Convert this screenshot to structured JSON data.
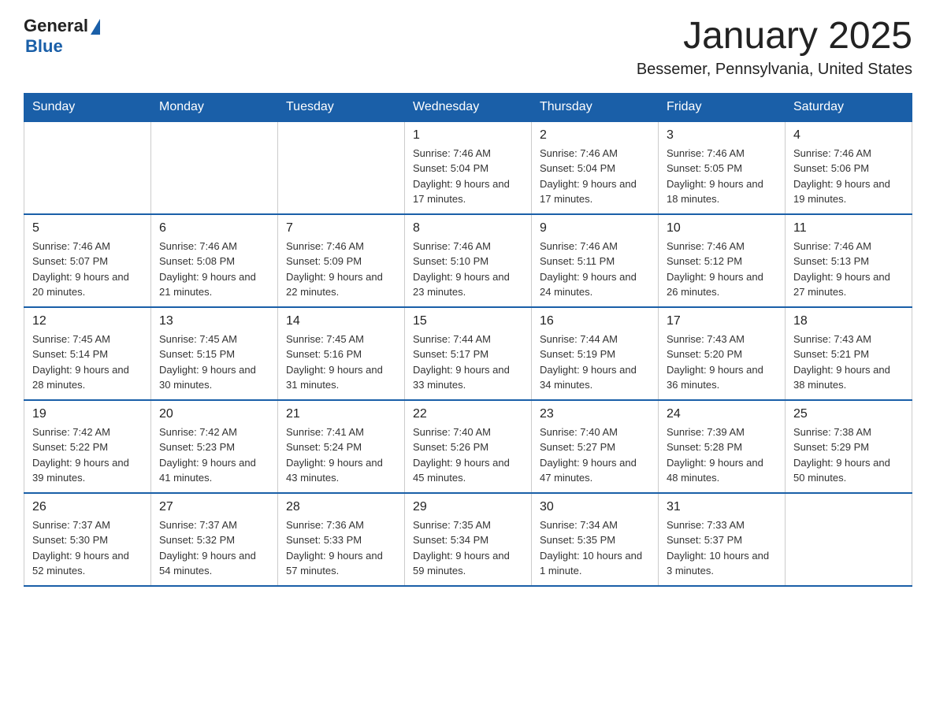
{
  "logo": {
    "general": "General",
    "blue": "Blue"
  },
  "title": "January 2025",
  "location": "Bessemer, Pennsylvania, United States",
  "days_of_week": [
    "Sunday",
    "Monday",
    "Tuesday",
    "Wednesday",
    "Thursday",
    "Friday",
    "Saturday"
  ],
  "weeks": [
    [
      {
        "day": "",
        "info": ""
      },
      {
        "day": "",
        "info": ""
      },
      {
        "day": "",
        "info": ""
      },
      {
        "day": "1",
        "info": "Sunrise: 7:46 AM\nSunset: 5:04 PM\nDaylight: 9 hours and 17 minutes."
      },
      {
        "day": "2",
        "info": "Sunrise: 7:46 AM\nSunset: 5:04 PM\nDaylight: 9 hours and 17 minutes."
      },
      {
        "day": "3",
        "info": "Sunrise: 7:46 AM\nSunset: 5:05 PM\nDaylight: 9 hours and 18 minutes."
      },
      {
        "day": "4",
        "info": "Sunrise: 7:46 AM\nSunset: 5:06 PM\nDaylight: 9 hours and 19 minutes."
      }
    ],
    [
      {
        "day": "5",
        "info": "Sunrise: 7:46 AM\nSunset: 5:07 PM\nDaylight: 9 hours and 20 minutes."
      },
      {
        "day": "6",
        "info": "Sunrise: 7:46 AM\nSunset: 5:08 PM\nDaylight: 9 hours and 21 minutes."
      },
      {
        "day": "7",
        "info": "Sunrise: 7:46 AM\nSunset: 5:09 PM\nDaylight: 9 hours and 22 minutes."
      },
      {
        "day": "8",
        "info": "Sunrise: 7:46 AM\nSunset: 5:10 PM\nDaylight: 9 hours and 23 minutes."
      },
      {
        "day": "9",
        "info": "Sunrise: 7:46 AM\nSunset: 5:11 PM\nDaylight: 9 hours and 24 minutes."
      },
      {
        "day": "10",
        "info": "Sunrise: 7:46 AM\nSunset: 5:12 PM\nDaylight: 9 hours and 26 minutes."
      },
      {
        "day": "11",
        "info": "Sunrise: 7:46 AM\nSunset: 5:13 PM\nDaylight: 9 hours and 27 minutes."
      }
    ],
    [
      {
        "day": "12",
        "info": "Sunrise: 7:45 AM\nSunset: 5:14 PM\nDaylight: 9 hours and 28 minutes."
      },
      {
        "day": "13",
        "info": "Sunrise: 7:45 AM\nSunset: 5:15 PM\nDaylight: 9 hours and 30 minutes."
      },
      {
        "day": "14",
        "info": "Sunrise: 7:45 AM\nSunset: 5:16 PM\nDaylight: 9 hours and 31 minutes."
      },
      {
        "day": "15",
        "info": "Sunrise: 7:44 AM\nSunset: 5:17 PM\nDaylight: 9 hours and 33 minutes."
      },
      {
        "day": "16",
        "info": "Sunrise: 7:44 AM\nSunset: 5:19 PM\nDaylight: 9 hours and 34 minutes."
      },
      {
        "day": "17",
        "info": "Sunrise: 7:43 AM\nSunset: 5:20 PM\nDaylight: 9 hours and 36 minutes."
      },
      {
        "day": "18",
        "info": "Sunrise: 7:43 AM\nSunset: 5:21 PM\nDaylight: 9 hours and 38 minutes."
      }
    ],
    [
      {
        "day": "19",
        "info": "Sunrise: 7:42 AM\nSunset: 5:22 PM\nDaylight: 9 hours and 39 minutes."
      },
      {
        "day": "20",
        "info": "Sunrise: 7:42 AM\nSunset: 5:23 PM\nDaylight: 9 hours and 41 minutes."
      },
      {
        "day": "21",
        "info": "Sunrise: 7:41 AM\nSunset: 5:24 PM\nDaylight: 9 hours and 43 minutes."
      },
      {
        "day": "22",
        "info": "Sunrise: 7:40 AM\nSunset: 5:26 PM\nDaylight: 9 hours and 45 minutes."
      },
      {
        "day": "23",
        "info": "Sunrise: 7:40 AM\nSunset: 5:27 PM\nDaylight: 9 hours and 47 minutes."
      },
      {
        "day": "24",
        "info": "Sunrise: 7:39 AM\nSunset: 5:28 PM\nDaylight: 9 hours and 48 minutes."
      },
      {
        "day": "25",
        "info": "Sunrise: 7:38 AM\nSunset: 5:29 PM\nDaylight: 9 hours and 50 minutes."
      }
    ],
    [
      {
        "day": "26",
        "info": "Sunrise: 7:37 AM\nSunset: 5:30 PM\nDaylight: 9 hours and 52 minutes."
      },
      {
        "day": "27",
        "info": "Sunrise: 7:37 AM\nSunset: 5:32 PM\nDaylight: 9 hours and 54 minutes."
      },
      {
        "day": "28",
        "info": "Sunrise: 7:36 AM\nSunset: 5:33 PM\nDaylight: 9 hours and 57 minutes."
      },
      {
        "day": "29",
        "info": "Sunrise: 7:35 AM\nSunset: 5:34 PM\nDaylight: 9 hours and 59 minutes."
      },
      {
        "day": "30",
        "info": "Sunrise: 7:34 AM\nSunset: 5:35 PM\nDaylight: 10 hours and 1 minute."
      },
      {
        "day": "31",
        "info": "Sunrise: 7:33 AM\nSunset: 5:37 PM\nDaylight: 10 hours and 3 minutes."
      },
      {
        "day": "",
        "info": ""
      }
    ]
  ]
}
